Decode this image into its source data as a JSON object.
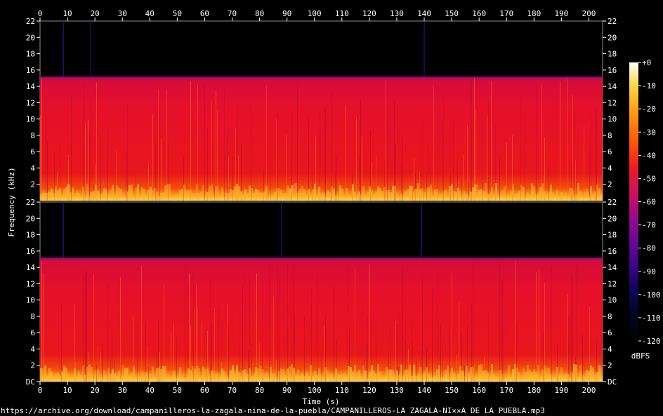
{
  "chart_data": {
    "type": "heatmap",
    "subtype": "spectrogram",
    "channels": 2,
    "xlabel": "Time (s)",
    "ylabel": "Frequency (kHz)",
    "xlim": [
      0,
      205
    ],
    "ylim": [
      0,
      22
    ],
    "x_ticks": [
      0,
      10,
      20,
      30,
      40,
      50,
      60,
      70,
      80,
      90,
      100,
      110,
      120,
      130,
      140,
      150,
      160,
      170,
      180,
      190,
      200
    ],
    "y_ticks": [
      {
        "value": 0,
        "label": "DC"
      },
      {
        "value": 2,
        "label": "2"
      },
      {
        "value": 4,
        "label": "4"
      },
      {
        "value": 6,
        "label": "6"
      },
      {
        "value": 8,
        "label": "8"
      },
      {
        "value": 10,
        "label": "10"
      },
      {
        "value": 12,
        "label": "12"
      },
      {
        "value": 14,
        "label": "14"
      },
      {
        "value": 16,
        "label": "16"
      },
      {
        "value": 18,
        "label": "18"
      },
      {
        "value": 20,
        "label": "20"
      },
      {
        "value": 22,
        "label": "22"
      }
    ],
    "cutoff_khz": 15.2,
    "colorbar": {
      "label": "dBFS",
      "range": [
        -120,
        0
      ],
      "ticks": [
        "+0",
        "-10",
        "-20",
        "-30",
        "-40",
        "-50",
        "-60",
        "-70",
        "-80",
        "-90",
        "-100",
        "-110",
        "-120"
      ]
    },
    "spikes": [
      {
        "channel": 1,
        "time": 8.5
      },
      {
        "channel": 1,
        "time": 18.5
      },
      {
        "channel": 1,
        "time": 140
      },
      {
        "channel": 2,
        "time": 8.5
      },
      {
        "channel": 2,
        "time": 88
      },
      {
        "channel": 2,
        "time": 139
      }
    ],
    "source": "https://archive.org/download/campanilleros-la-zagala-nina-de-la-puebla/CAMPANILLEROS-LA ZAGALA-NI××A DE LA PUEBLA.mp3"
  }
}
